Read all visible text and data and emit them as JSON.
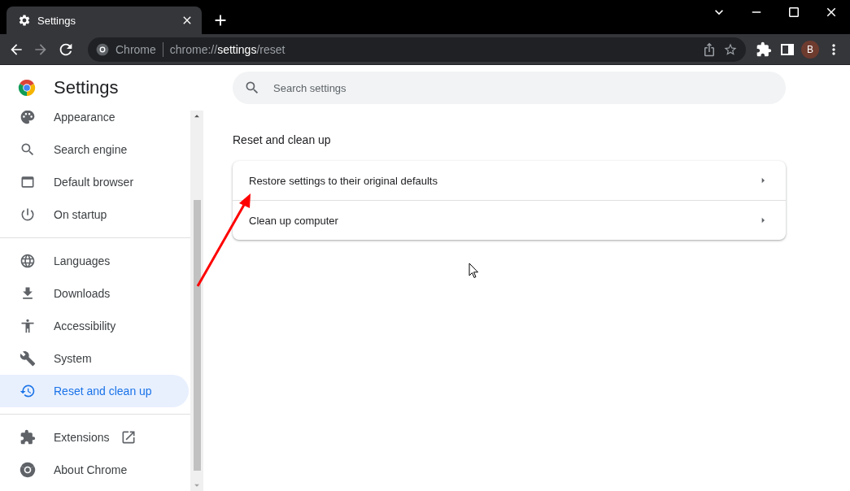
{
  "tab": {
    "title": "Settings"
  },
  "address_bar": {
    "site_label": "Chrome",
    "url": "chrome://**settings**/reset"
  },
  "profile": {
    "initial": "B"
  },
  "sidebar": {
    "title": "Settings",
    "groups": [
      {
        "items": [
          {
            "label": "Appearance",
            "selected": false,
            "external": false
          },
          {
            "label": "Search engine",
            "selected": false,
            "external": false
          },
          {
            "label": "Default browser",
            "selected": false,
            "external": false
          },
          {
            "label": "On startup",
            "selected": false,
            "external": false
          }
        ]
      },
      {
        "items": [
          {
            "label": "Languages",
            "selected": false,
            "external": false
          },
          {
            "label": "Downloads",
            "selected": false,
            "external": false
          },
          {
            "label": "Accessibility",
            "selected": false,
            "external": false
          },
          {
            "label": "System",
            "selected": false,
            "external": false
          },
          {
            "label": "Reset and clean up",
            "selected": true,
            "external": false
          }
        ]
      },
      {
        "items": [
          {
            "label": "Extensions",
            "selected": false,
            "external": true
          },
          {
            "label": "About Chrome",
            "selected": false,
            "external": false
          }
        ]
      }
    ]
  },
  "search": {
    "placeholder": "Search settings"
  },
  "section": {
    "title": "Reset and clean up",
    "rows": [
      {
        "label": "Restore settings to their original defaults"
      },
      {
        "label": "Clean up computer"
      }
    ]
  }
}
